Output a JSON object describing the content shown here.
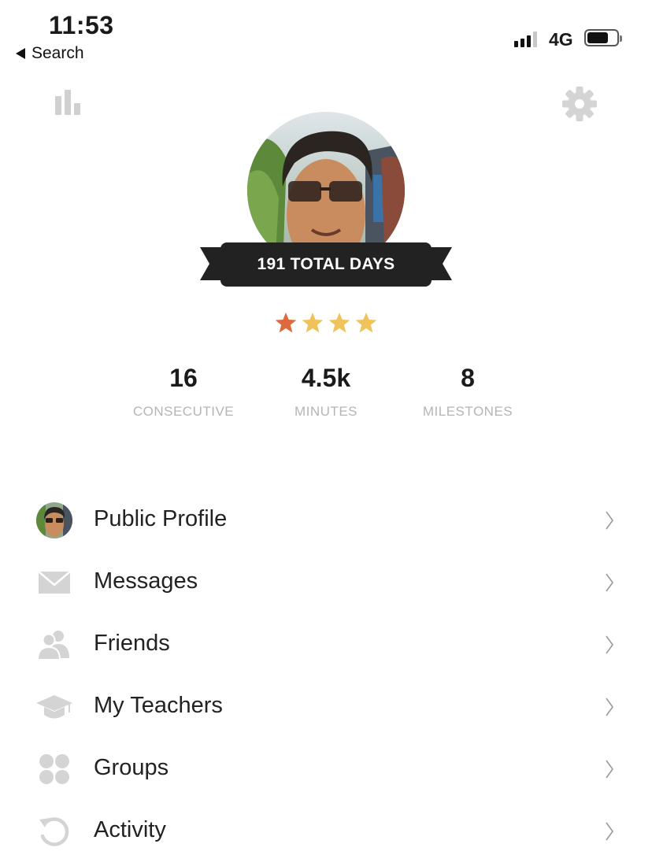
{
  "status_bar": {
    "time": "11:53",
    "back_label": "Search",
    "network": "4G",
    "battery_level": 0.72
  },
  "header": {
    "left_icon": "stats-bar-chart-icon",
    "right_icon": "gear-icon"
  },
  "profile": {
    "total_days_label": "191 TOTAL DAYS",
    "stars": {
      "colors": [
        "#dc6a3c",
        "#efc25a",
        "#efc25a",
        "#efc25a"
      ]
    },
    "stats": [
      {
        "value": "16",
        "label": "CONSECUTIVE"
      },
      {
        "value": "4.5k",
        "label": "MINUTES"
      },
      {
        "value": "8",
        "label": "MILESTONES"
      }
    ]
  },
  "menu": [
    {
      "label": "Public Profile",
      "icon": "avatar-icon"
    },
    {
      "label": "Messages",
      "icon": "envelope-icon"
    },
    {
      "label": "Friends",
      "icon": "people-icon"
    },
    {
      "label": "My Teachers",
      "icon": "graduation-cap-icon"
    },
    {
      "label": "Groups",
      "icon": "groups-dots-icon"
    },
    {
      "label": "Activity",
      "icon": "history-arrow-icon"
    }
  ],
  "colors": {
    "ribbon": "#222222",
    "icon_gray": "#cfcfcf",
    "label_gray": "#b5b5b5"
  }
}
